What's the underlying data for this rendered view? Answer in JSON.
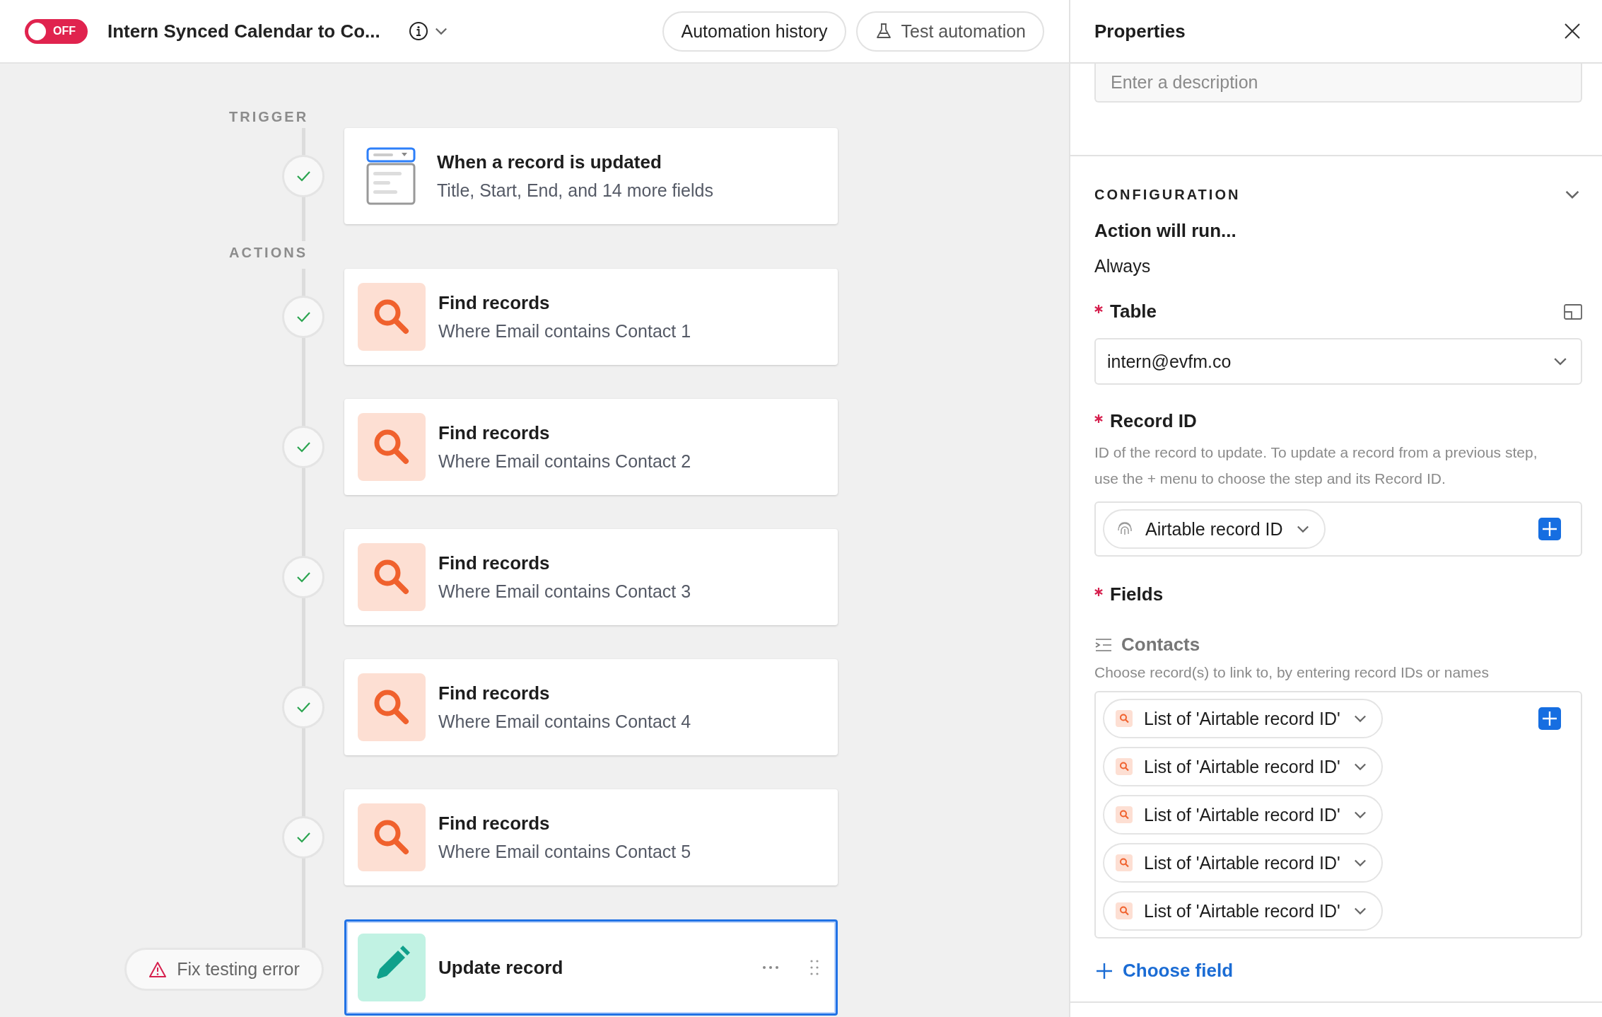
{
  "automation": {
    "enabled": false,
    "toggle_label": "OFF",
    "name": "Intern Synced Calendar to Co..."
  },
  "toolbar_buttons": [
    {
      "label": "Automation history",
      "kind": "plain"
    },
    {
      "label": "Test automation",
      "kind": "flask"
    }
  ],
  "canvas": {
    "trigger_heading": "TRIGGER",
    "trigger": {
      "kind": "record-updated",
      "title": "When a record is updated",
      "subtitle": "Title, Start, End, and 14 more fields",
      "passed": true
    },
    "actions_heading": "ACTIONS",
    "actions": [
      {
        "kind": "find",
        "title": "Find records",
        "subtitle": "Where Email contains Contact 1",
        "passed": true,
        "selected": false
      },
      {
        "kind": "find",
        "title": "Find records",
        "subtitle": "Where Email contains Contact 2",
        "passed": true,
        "selected": false
      },
      {
        "kind": "find",
        "title": "Find records",
        "subtitle": "Where Email contains Contact 3",
        "passed": true,
        "selected": false
      },
      {
        "kind": "find",
        "title": "Find records",
        "subtitle": "Where Email contains Contact 4",
        "passed": true,
        "selected": false
      },
      {
        "kind": "find",
        "title": "Find records",
        "subtitle": "Where Email contains Contact 5",
        "passed": true,
        "selected": false
      },
      {
        "kind": "update",
        "title": "Update record",
        "passed": false,
        "error_label": "Fix testing error",
        "selected": true
      }
    ]
  },
  "properties": {
    "title": "Properties",
    "description": {
      "placeholder": "Enter a description"
    },
    "configuration": {
      "heading": "CONFIGURATION",
      "run_label": "Action will run...",
      "run_value": "Always",
      "table": {
        "label": "Table",
        "required": true,
        "value": "intern@evfm.co"
      },
      "record_id": {
        "label": "Record ID",
        "required": true,
        "help": "ID of the record to update. To update a record from a previous step, use the + menu to choose the step and its Record ID.",
        "tokens": [
          {
            "kind": "record-id",
            "label": "Airtable record ID"
          }
        ]
      },
      "fields": {
        "label": "Fields",
        "required": true,
        "items": [
          {
            "name": "Contacts",
            "help": "Choose record(s) to link to, by entering record IDs or names",
            "tokens": [
              {
                "kind": "step-output",
                "label": "List of 'Airtable record ID'"
              },
              {
                "kind": "step-output",
                "label": "List of 'Airtable record ID'"
              },
              {
                "kind": "step-output",
                "label": "List of 'Airtable record ID'"
              },
              {
                "kind": "step-output",
                "label": "List of 'Airtable record ID'"
              },
              {
                "kind": "step-output",
                "label": "List of 'Airtable record ID'"
              }
            ]
          }
        ]
      },
      "choose_field": "Choose field"
    }
  }
}
